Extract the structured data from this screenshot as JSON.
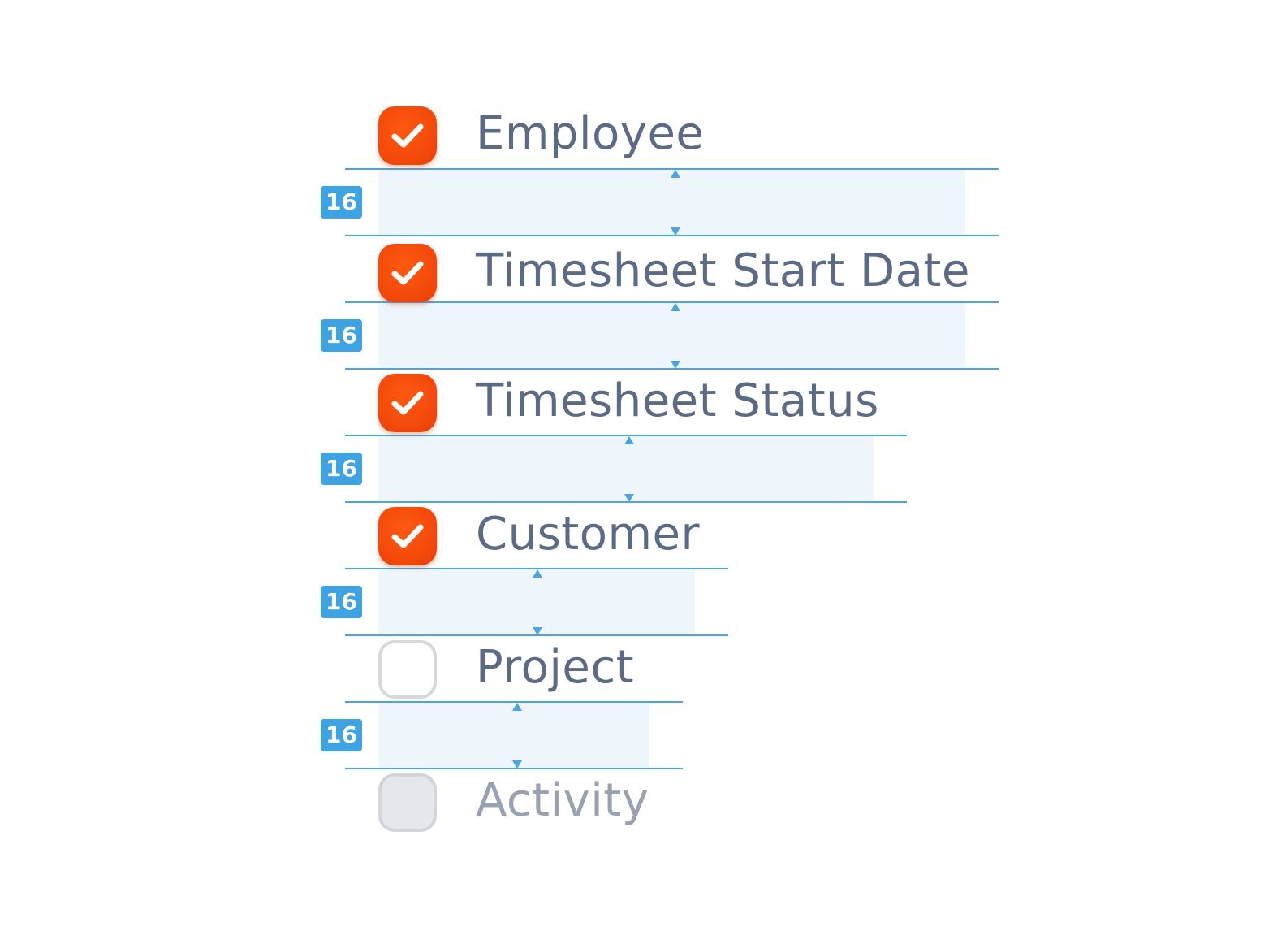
{
  "options": [
    {
      "label": "Employee",
      "state": "checked",
      "checked": true
    },
    {
      "label": "Timesheet Start Date",
      "state": "checked",
      "checked": true
    },
    {
      "label": "Timesheet Status",
      "state": "checked",
      "checked": true
    },
    {
      "label": "Customer",
      "state": "checked",
      "checked": true
    },
    {
      "label": "Project",
      "state": "unchecked",
      "checked": false
    },
    {
      "label": "Activity",
      "state": "disabled",
      "checked": false
    }
  ],
  "spacing": [
    {
      "value": "16"
    },
    {
      "value": "16"
    },
    {
      "value": "16"
    },
    {
      "value": "16"
    },
    {
      "value": "16"
    }
  ],
  "colors": {
    "checkbox_checked": "#f2470a",
    "label_text": "#5c6b85",
    "label_disabled": "#98a1b0",
    "guide_line": "#4aa5e0",
    "spacing_band": "#eef6fc",
    "badge": "#3ea3e3"
  },
  "icons": {
    "checked": "checkmark-icon"
  }
}
